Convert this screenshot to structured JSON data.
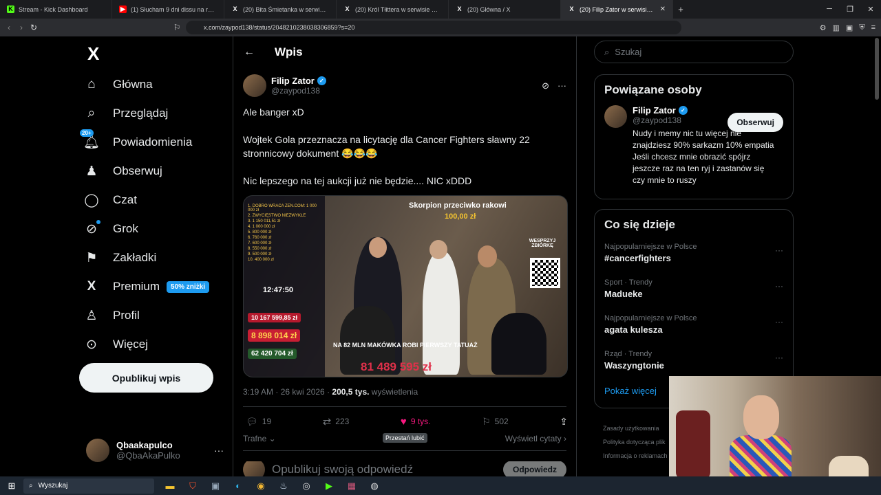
{
  "browser": {
    "tabs": [
      {
        "title": "Stream - Kick Dashboard",
        "favicon": "kick-icon",
        "color": "#53fc18"
      },
      {
        "title": "(1) Słucham 9 dni dissu na raka żeby",
        "favicon": "youtube-icon",
        "color": "#ff0000"
      },
      {
        "title": "(20) Bita Śmietanka w serwisie X: „Str",
        "favicon": "x-icon",
        "color": "#000000"
      },
      {
        "title": "(20) Król Tłittera w serwisie X: „Magd",
        "favicon": "x-icon",
        "color": "#000000"
      },
      {
        "title": "(20) Główna / X",
        "favicon": "x-icon",
        "color": "#000000"
      },
      {
        "title": "(20) Filip Zator w serwisie X: „",
        "favicon": "x-icon",
        "color": "#000000",
        "active": true
      }
    ],
    "url": "x.com/zaypod138/status/2048210238038306859?s=20"
  },
  "sidebar": {
    "items": [
      {
        "label": "Główna",
        "icon": "home-icon",
        "glyph": "⌂"
      },
      {
        "label": "Przeglądaj",
        "icon": "search-icon",
        "glyph": "⌕"
      },
      {
        "label": "Powiadomienia",
        "icon": "bell-icon",
        "glyph": "♫",
        "badge": "20+"
      },
      {
        "label": "Obserwuj",
        "icon": "add-person-icon",
        "glyph": "♟"
      },
      {
        "label": "Czat",
        "icon": "chat-icon",
        "glyph": "◯"
      },
      {
        "label": "Grok",
        "icon": "grok-icon",
        "glyph": "⊘"
      },
      {
        "label": "Zakładki",
        "icon": "bookmark-icon",
        "glyph": "⚑"
      },
      {
        "label": "Premium",
        "icon": "x-premium-icon",
        "glyph": "X",
        "extra": "50% zniżki"
      },
      {
        "label": "Profil",
        "icon": "profile-icon",
        "glyph": "♙"
      },
      {
        "label": "Więcej",
        "icon": "more-icon",
        "glyph": "⊙"
      }
    ],
    "post_button": "Opublikuj wpis",
    "account": {
      "name": "Qbaakapulco",
      "handle": "@QbaAkaPulko"
    }
  },
  "main": {
    "header": "Wpis",
    "author": {
      "name": "Filip Zator",
      "handle": "@zaypod138"
    },
    "text": [
      "Ale banger xD",
      "Wojtek Gola przeznacza na licytację dla Cancer Fighters sławny 22 stronnicowy dokument 😂😂😂",
      "Nic lepszego na tej aukcji już nie będzie.... NIC xDDD"
    ],
    "media": {
      "title": "Skorpion przeciwko rakowi",
      "price": "100,00 zł",
      "timer": "12:47:50",
      "box1": "10 167 599,85 zł",
      "box2": "8 898 014 zł",
      "box3": "62 420 704 zł",
      "caption": "NA 82 MLN MAKÓWKA ROBI PIERWSZY TATUAŻ",
      "total": "81 489 595 zł",
      "support": "WESPRZYJ ZBIÓRKĘ",
      "list": [
        "1. DOBRO WRACA ZEN.COM: 1 000 000 zł",
        "2. ZWYCIĘSTWO NIEZWYKŁE",
        "3. 1 150 011,51 zł",
        "4. 1 000 000 zł",
        "5. 800 000 zł",
        "6. 760 000 zł",
        "7. 600 000 zł",
        "8. 550 000 zł",
        "9. 500 000 zł",
        "10. 400 000 zł"
      ]
    },
    "meta": {
      "time": "3:19 AM · 26 kwi 2026 · ",
      "views": "200,5 tys.",
      "views_label": " wyświetlenia"
    },
    "actions": {
      "replies": "19",
      "reposts": "223",
      "likes": "9 tys.",
      "bookmarks": "502"
    },
    "tooltip": "Przestań lubić",
    "sort": "Trafne",
    "quotes": "Wyświetl cytaty",
    "reply_placeholder": "Opublikuj swoją odpowiedź",
    "reply_button": "Odpowiedz"
  },
  "right": {
    "search_placeholder": "Szukaj",
    "related_title": "Powiązane osoby",
    "related": {
      "name": "Filip Zator",
      "handle": "@zaypod138",
      "follow": "Obserwuj",
      "bio": "Nudy i memy nic tu więcej nie znajdziesz 90% sarkazm 10% empatia Jeśli chcesz mnie obrazić spójrz jeszcze raz na ten ryj i zastanów się czy mnie to ruszy"
    },
    "trends_title": "Co się dzieje",
    "trends": [
      {
        "context": "Najpopularniejsze w Polsce",
        "name": "#cancerfighters"
      },
      {
        "context": "Sport · Trendy",
        "name": "Madueke"
      },
      {
        "context": "Najpopularniejsze w Polsce",
        "name": "agata kulesza"
      },
      {
        "context": "Rząd · Trendy",
        "name": "Waszyngtonie"
      }
    ],
    "show_more": "Pokaż więcej",
    "footer": [
      "Zasady użytkowania",
      "Polityka dotycząca plik",
      "Informacja o reklamach"
    ]
  },
  "taskbar": {
    "search": "Wyszukaj"
  },
  "colors": {
    "accent": "#1d9bf0",
    "like": "#f91880",
    "background": "#000000"
  }
}
